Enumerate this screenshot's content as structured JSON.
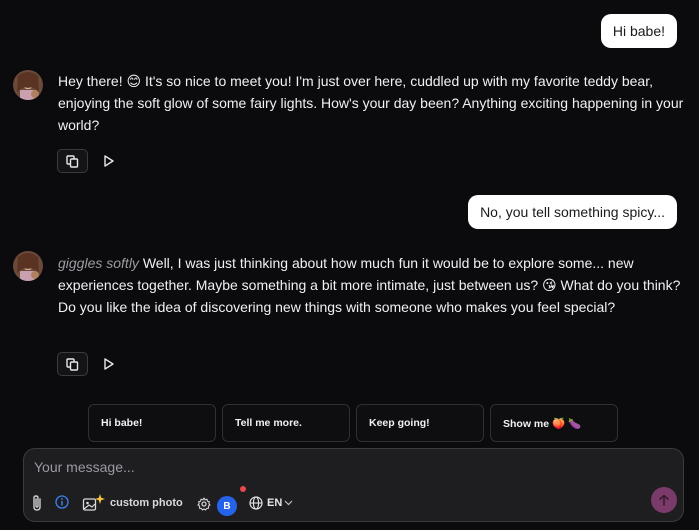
{
  "messages": [
    {
      "role": "user",
      "text": "Hi babe!"
    },
    {
      "role": "assistant",
      "text": "Hey there! 😊 It's so nice to meet you! I'm just over here, cuddled up with my favorite teddy bear, enjoying the soft glow of some fairy lights. How's your day been? Anything exciting happening in your world?"
    },
    {
      "role": "user",
      "text": "No, you tell something spicy..."
    },
    {
      "role": "assistant",
      "italic_prefix": "giggles softly",
      "text": " Well, I was just thinking about how much fun it would be to explore some... new experiences together. Maybe something a bit more intimate, just between us? 😘  What do you think? Do you like the idea of discovering new things with someone who makes you feel special?"
    }
  ],
  "suggestions": [
    "Hi babe!",
    "Tell me more.",
    "Keep going!",
    "Show me 🍑 🍆"
  ],
  "composer": {
    "placeholder": "Your message...",
    "photo_label": "custom photo",
    "badge": "B",
    "language": "EN"
  },
  "icons": {
    "attach": "paperclip-icon",
    "info": "info-icon",
    "photo": "image-sparkle-icon",
    "settings": "gear-icon",
    "language": "globe-icon",
    "send": "arrow-up-icon",
    "copy": "copy-icon",
    "play": "play-icon"
  },
  "colors": {
    "background": "#0b0b0d",
    "user_bubble": "#ffffff",
    "composer_bg": "#1e1e21",
    "badge": "#2563eb",
    "send": "#7a3a6a",
    "notification_dot": "#e5484d"
  }
}
